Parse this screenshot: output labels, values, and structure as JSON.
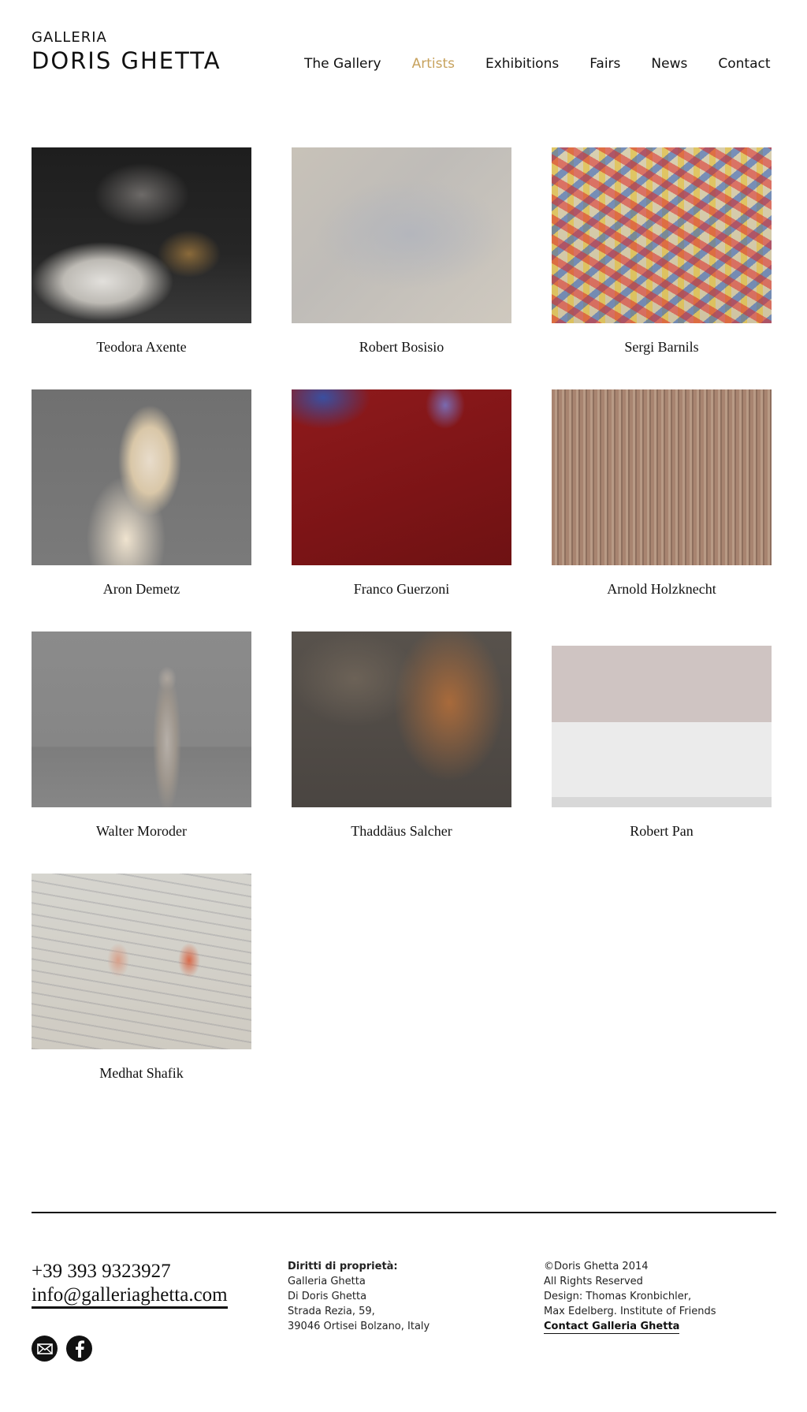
{
  "header": {
    "logo_small": "GALLERIA",
    "logo_big": "DORIS GHETTA",
    "nav": [
      {
        "label": "The Gallery",
        "active": false
      },
      {
        "label": "Artists",
        "active": true
      },
      {
        "label": "Exhibitions",
        "active": false
      },
      {
        "label": "Fairs",
        "active": false
      },
      {
        "label": "News",
        "active": false
      },
      {
        "label": "Contact",
        "active": false
      }
    ],
    "active_color": "#c7a25d"
  },
  "artists": [
    {
      "name": "Teodora Axente"
    },
    {
      "name": "Robert Bosisio"
    },
    {
      "name": "Sergi Barnils"
    },
    {
      "name": "Aron Demetz"
    },
    {
      "name": "Franco Guerzoni"
    },
    {
      "name": "Arnold Holzknecht"
    },
    {
      "name": "Walter Moroder"
    },
    {
      "name": "Thaddäus Salcher"
    },
    {
      "name": "Robert Pan"
    },
    {
      "name": "Medhat Shafik"
    }
  ],
  "footer": {
    "phone": "+39 393 9323927",
    "email": "info@galleriaghetta.com",
    "social_icons": [
      "mail-icon",
      "facebook-icon"
    ],
    "rights": {
      "heading": "Diritti di proprietà:",
      "lines": [
        "Galleria Ghetta",
        "Di Doris Ghetta",
        "Strada Rezia, 59,",
        "39046 Ortisei Bolzano, Italy"
      ]
    },
    "credits": {
      "lines": [
        "©Doris Ghetta 2014",
        "All Rights Reserved",
        "Design: Thomas Kronbichler,",
        "Max Edelberg. Institute of Friends"
      ],
      "link_label": "Contact Galleria Ghetta"
    }
  }
}
